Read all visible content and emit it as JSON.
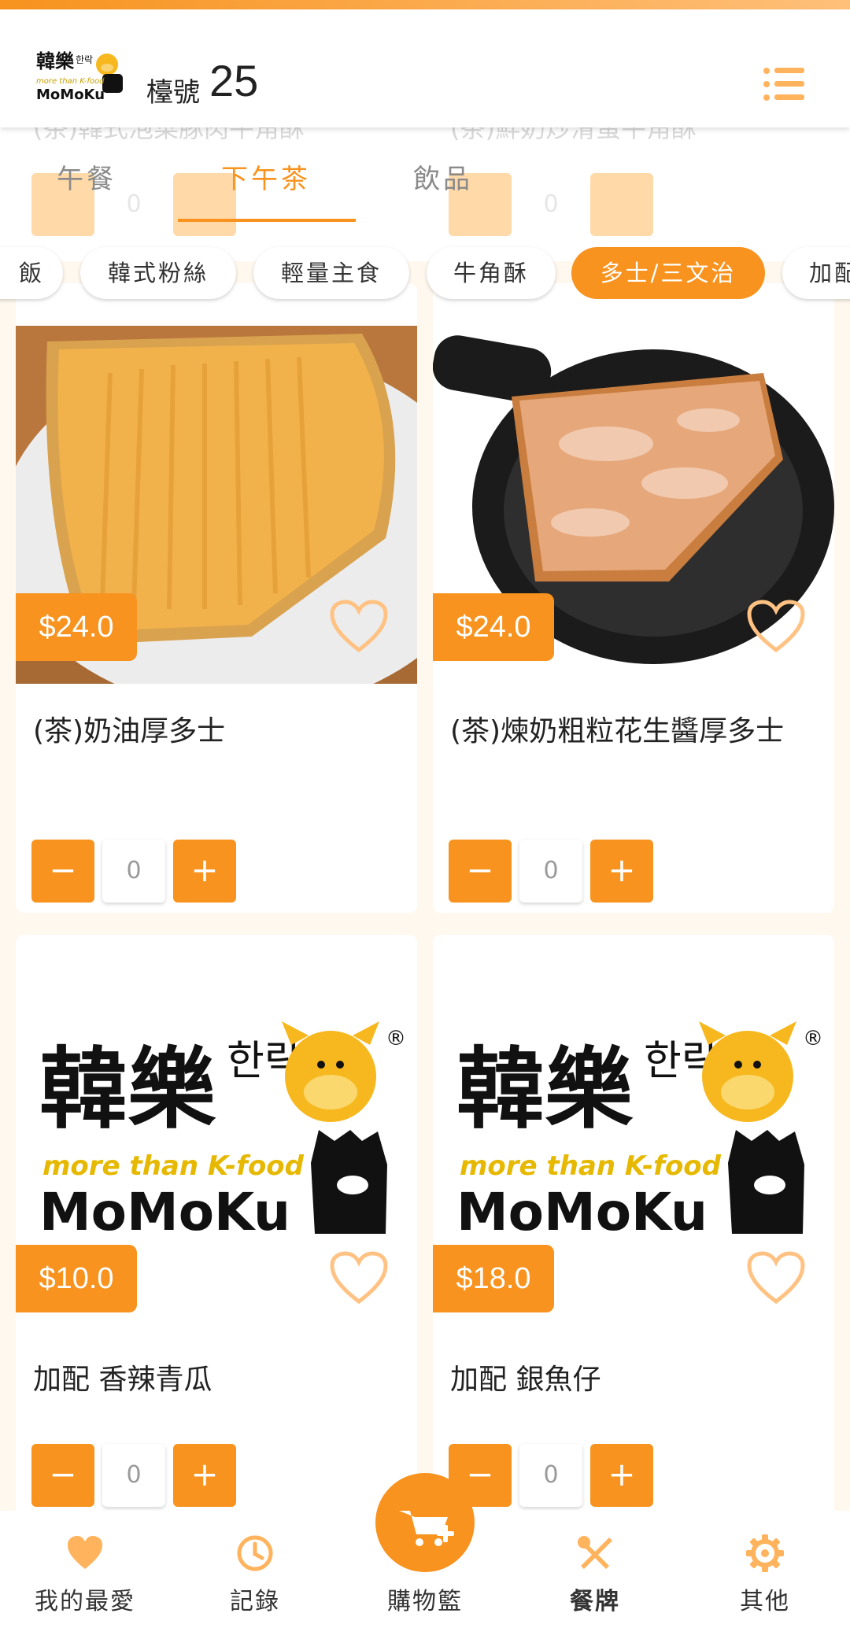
{
  "header": {
    "table_label": "檯號",
    "table_number": "25"
  },
  "ghost_row": {
    "left_title": "(茶)韓式泡菜豚肉牛角酥",
    "right_title": "(茶)鮮奶炒滑蛋牛角酥",
    "qty": "0"
  },
  "tabs": [
    {
      "label": "午餐"
    },
    {
      "label": "下午茶",
      "active": true
    },
    {
      "label": "飲品"
    }
  ],
  "categories": [
    {
      "label": "飯"
    },
    {
      "label": "韓式粉絲"
    },
    {
      "label": "輕量主食"
    },
    {
      "label": "牛角酥"
    },
    {
      "label": "多士/三文治",
      "active": true
    },
    {
      "label": "加配"
    }
  ],
  "items": [
    {
      "title": "(茶)奶油厚多士",
      "price": "$24.0",
      "qty": "0"
    },
    {
      "title": "(茶)煉奶粗粒花生醬厚多士",
      "price": "$24.0",
      "qty": "0"
    },
    {
      "title": "加配 香辣青瓜",
      "price": "$10.0",
      "qty": "0"
    },
    {
      "title": "加配 銀魚仔",
      "price": "$18.0",
      "qty": "0"
    }
  ],
  "logo": {
    "cn": "韓樂",
    "kr": "한락",
    "tagline": "more than K-food",
    "name": "MoMoKu",
    "mark": "®"
  },
  "qty_buttons": {
    "minus": "−",
    "plus": "+"
  },
  "bottom_nav": [
    {
      "label": "我的最愛",
      "icon": "heart-icon"
    },
    {
      "label": "記錄",
      "icon": "clock-icon"
    },
    {
      "label": "購物籃",
      "icon": "cart-icon"
    },
    {
      "label": "餐牌",
      "icon": "utensils-icon",
      "active": true
    },
    {
      "label": "其他",
      "icon": "gear-icon"
    }
  ],
  "colors": {
    "accent": "#f7931e",
    "background": "#fff8ee"
  }
}
